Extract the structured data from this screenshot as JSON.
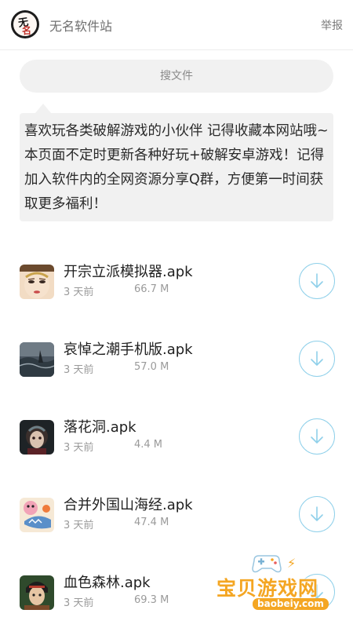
{
  "header": {
    "logo_text": "无名",
    "site_name": "无名软件站",
    "report_label": "举报"
  },
  "search": {
    "placeholder": "搜文件"
  },
  "notice": {
    "text": "喜欢玩各类破解游戏的小伙伴 记得收藏本网站哦~本页面不定时更新各种好玩+破解安卓游戏！记得加入软件内的全网资源分享Q群，方便第一时间获取更多福利！"
  },
  "files": [
    {
      "name": "开宗立派模拟器.apk",
      "date": "3 天前",
      "size": "66.7 M",
      "icon": "face-character-icon"
    },
    {
      "name": "哀悼之潮手机版.apk",
      "date": "3 天前",
      "size": "57.0 M",
      "icon": "ocean-scene-icon"
    },
    {
      "name": "落花洞.apk",
      "date": "3 天前",
      "size": "4.4 M",
      "icon": "dark-girl-icon"
    },
    {
      "name": "合并外国山海经.apk",
      "date": "3 天前",
      "size": "47.4 M",
      "icon": "cartoon-creature-icon"
    },
    {
      "name": "血色森林.apk",
      "date": "3 天前",
      "size": "69.3 M",
      "icon": "warrior-portrait-icon"
    }
  ],
  "watermark": {
    "brand": "宝贝游戏网",
    "url": "baobeiy.com"
  },
  "colors": {
    "accent": "#8fd0ea",
    "watermark": "#f4a623",
    "panel": "#f1f1f1"
  }
}
